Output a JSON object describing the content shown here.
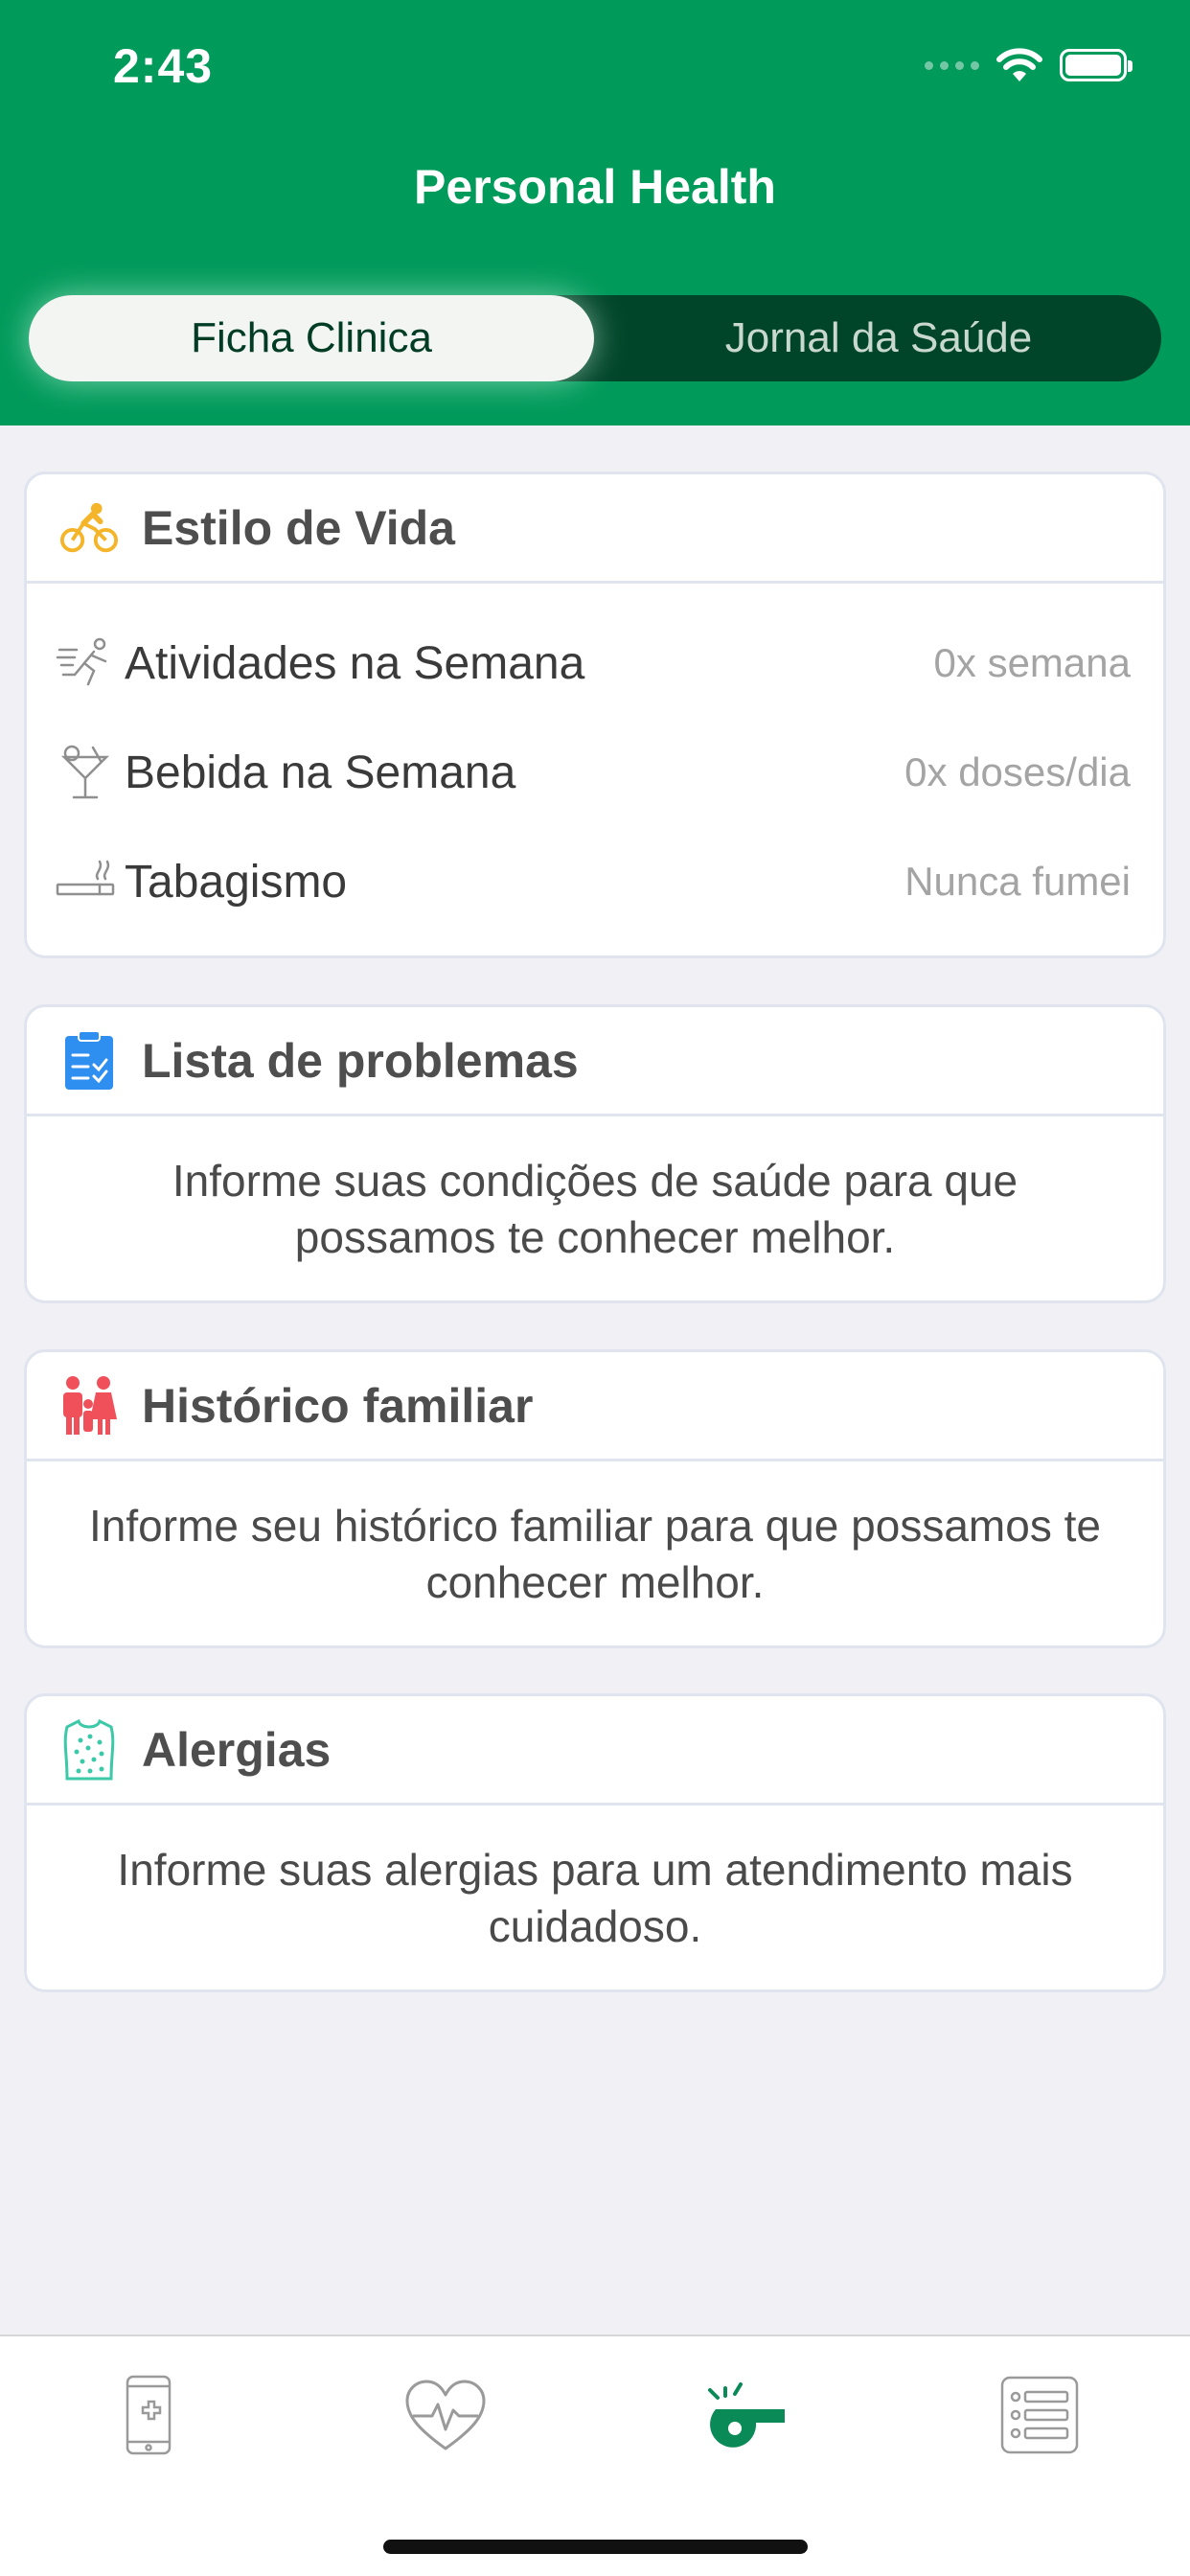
{
  "status_bar": {
    "time": "2:43"
  },
  "header": {
    "title": "Personal Health"
  },
  "segment": {
    "tabs": [
      {
        "label": "Ficha Clinica",
        "active": true
      },
      {
        "label": "Jornal da Saúde",
        "active": false
      }
    ]
  },
  "lifestyle": {
    "title": "Estilo de Vida",
    "icon": "cyclist-icon",
    "rows": [
      {
        "label": "Atividades na Semana",
        "value": "0x semana",
        "icon": "runner-icon"
      },
      {
        "label": "Bebida na Semana",
        "value": "0x doses/dia",
        "icon": "cocktail-icon"
      },
      {
        "label": "Tabagismo",
        "value": "Nunca fumei",
        "icon": "cigarette-icon"
      }
    ]
  },
  "problems": {
    "title": "Lista de problemas",
    "icon": "clipboard-checklist-icon",
    "description": "Informe suas condições de saúde para que possamos te conhecer melhor."
  },
  "family": {
    "title": "Histórico familiar",
    "icon": "family-icon",
    "description": "Informe seu histórico familiar para que possamos te conhecer melhor."
  },
  "allergies": {
    "title": "Alergias",
    "icon": "skin-allergy-icon",
    "description": "Informe suas alergias para um atendimento mais cuidadoso."
  },
  "tab_bar": {
    "items": [
      {
        "name": "phone-medical-icon",
        "active": false
      },
      {
        "name": "heart-pulse-icon",
        "active": false
      },
      {
        "name": "whistle-icon",
        "active": true
      },
      {
        "name": "list-icon",
        "active": false
      }
    ]
  },
  "colors": {
    "brand_green": "#009a5b",
    "segment_dark": "#00452a",
    "tab_active": "#0a8a56",
    "icon_yellow": "#f5b52a",
    "icon_blue": "#2f8ff0",
    "icon_red": "#f0505a",
    "icon_teal": "#3cc9a8"
  }
}
